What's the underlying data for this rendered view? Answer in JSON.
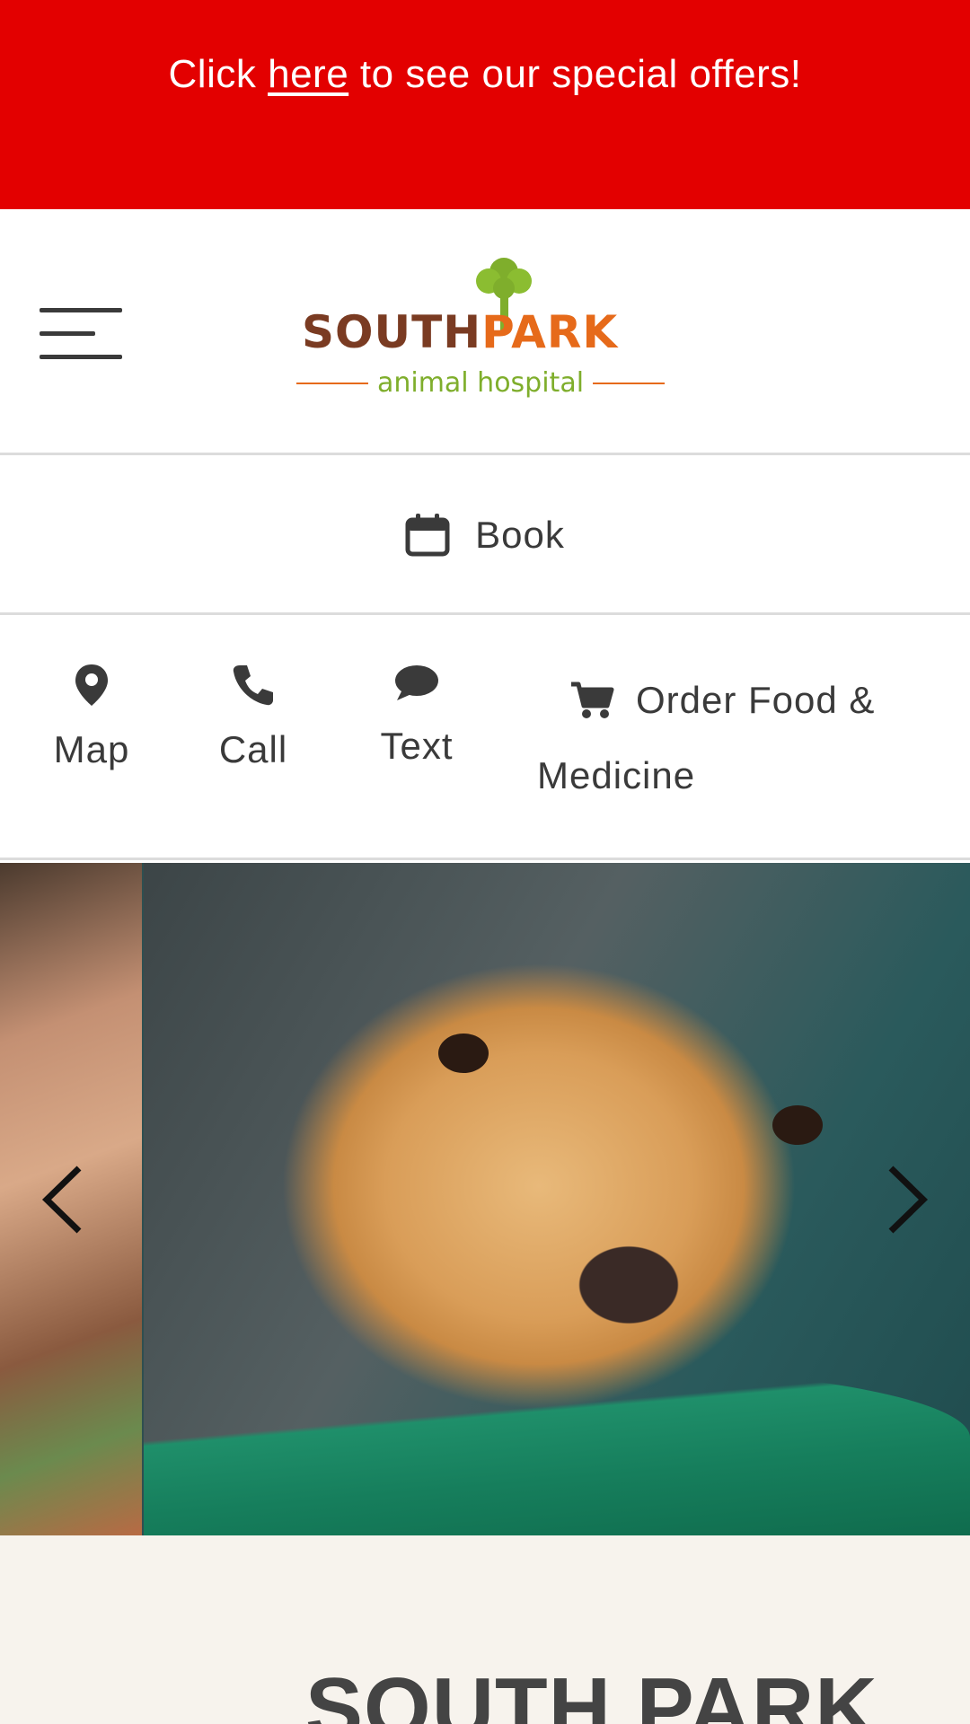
{
  "promo": {
    "prefix": "Click ",
    "link": "here",
    "suffix": " to see our special offers!"
  },
  "header": {
    "logo_name_1": "SOUTH",
    "logo_name_2": "PARK",
    "logo_tagline": "animal hospital"
  },
  "book": {
    "label": "Book",
    "icon": "calendar-icon"
  },
  "actions": {
    "map": {
      "label": "Map",
      "icon": "map-pin-icon"
    },
    "call": {
      "label": "Call",
      "icon": "phone-icon"
    },
    "text": {
      "label": "Text",
      "icon": "chat-bubble-icon"
    },
    "order": {
      "label_1": "Order Food &",
      "label_2": "Medicine",
      "icon": "cart-icon"
    }
  },
  "intro": {
    "title": "SOUTH PARK"
  },
  "colors": {
    "banner": "#e30000",
    "logo_brown": "#7a3b22",
    "logo_orange": "#e66a1a",
    "logo_green": "#7fae2c"
  }
}
